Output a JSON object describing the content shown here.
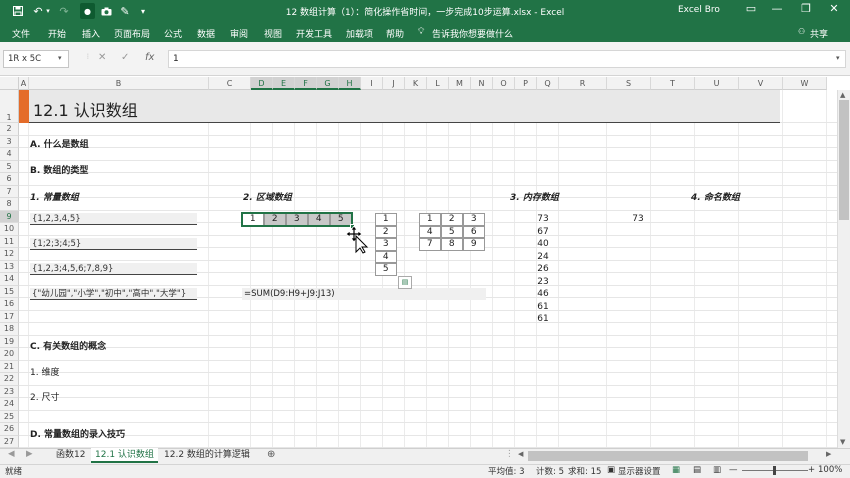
{
  "window": {
    "title": "12 数组计算（1）：简化操作省时间，一步完成10步运算.xlsx  -  Excel",
    "user": "Excel Bro",
    "qat": {
      "save": "save-icon",
      "undo": "undo-icon",
      "redo": "redo-icon",
      "touch": "touch-mode-icon",
      "camera": "camera-icon",
      "brush": "format-painter-icon",
      "more": "customize-icon"
    },
    "controls": {
      "ribbon_display": "▭",
      "minimize": "—",
      "restore": "❐",
      "close": "✕"
    }
  },
  "ribbon": {
    "tabs": [
      "文件",
      "开始",
      "插入",
      "页面布局",
      "公式",
      "数据",
      "审阅",
      "视图",
      "开发工具",
      "加载项",
      "帮助"
    ],
    "tell_me": "告诉我你想要做什么",
    "share": "共享"
  },
  "formula_bar": {
    "name_box": "1R x 5C",
    "cancel": "✕",
    "enter": "✓",
    "fx": "fx",
    "formula": "1"
  },
  "columns": [
    "A",
    "B",
    "C",
    "D",
    "E",
    "F",
    "G",
    "H",
    "I",
    "J",
    "K",
    "L",
    "M",
    "N",
    "O",
    "P",
    "Q",
    "R",
    "S",
    "T",
    "U",
    "V",
    "W"
  ],
  "rows": [
    "1",
    "2",
    "3",
    "4",
    "5",
    "6",
    "7",
    "8",
    "9",
    "10",
    "11",
    "12",
    "13",
    "14",
    "15",
    "16",
    "17",
    "18",
    "19",
    "20",
    "21",
    "22",
    "23",
    "24",
    "25",
    "26",
    "27"
  ],
  "sheet": {
    "title": "12.1 认识数组",
    "sec_a": "A. 什么是数组",
    "sec_b": "B. 数组的类型",
    "sub1": "1. 常量数组",
    "sub2": "2. 区域数组",
    "sub3": "3. 内存数组",
    "sub4": "4. 命名数组",
    "const_arrays": [
      "{1,2,3,4,5}",
      "{1;2;3;4;5}",
      "{1,2,3;4,5,6;7,8,9}",
      "{\"幼儿园\",\"小学\",\"初中\",\"高中\",\"大学\"}"
    ],
    "row_array": [
      "1",
      "2",
      "3",
      "4",
      "5"
    ],
    "col_array": [
      "1",
      "2",
      "3",
      "4",
      "5"
    ],
    "matrix": [
      [
        "1",
        "2",
        "3"
      ],
      [
        "4",
        "5",
        "6"
      ],
      [
        "7",
        "8",
        "9"
      ]
    ],
    "sum_formula": "=SUM(D9:H9+J9:J13)",
    "memory_values": [
      "73",
      "67",
      "40",
      "24",
      "26",
      "23",
      "46",
      "61",
      "61"
    ],
    "named_value": "73",
    "sec_c": "C. 有关数组的概念",
    "c1": "1. 维度",
    "c2": "2. 尺寸",
    "sec_d": "D. 常量数组的录入技巧"
  },
  "sheet_tabs": [
    "函数12",
    "12.1 认识数组",
    "12.2 数组的计算逻辑"
  ],
  "active_tab": "12.1 认识数组",
  "status": {
    "mode": "就绪",
    "average": "平均值: 3",
    "count": "计数: 5",
    "sum": "求和: 15",
    "display_settings": "显示器设置",
    "zoom": "100%"
  },
  "colors": {
    "accent": "#217346",
    "title_bar": "#e46c2a"
  }
}
